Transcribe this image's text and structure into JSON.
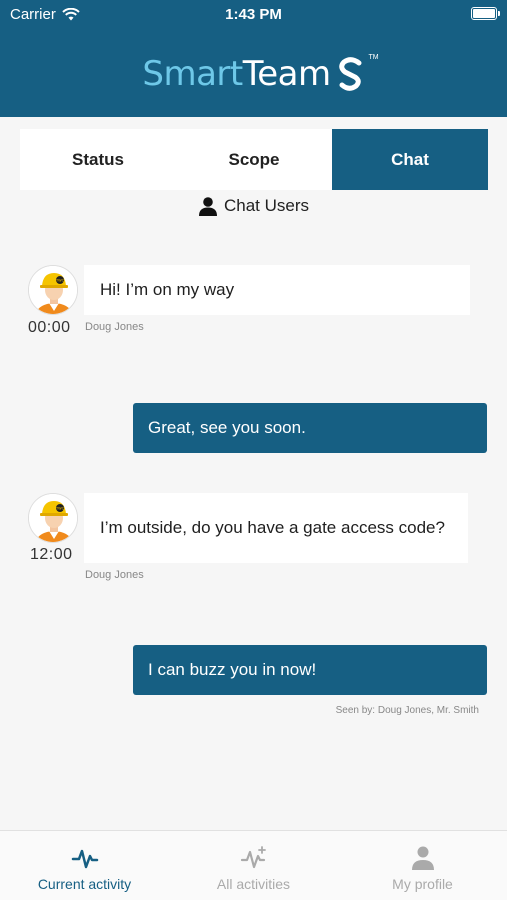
{
  "status_bar": {
    "carrier": "Carrier",
    "time": "1:43 PM"
  },
  "logo": {
    "smart": "Smart",
    "team": "Team",
    "tm": "TM"
  },
  "tabs": [
    {
      "label": "Status",
      "active": false
    },
    {
      "label": "Scope",
      "active": false
    },
    {
      "label": "Chat",
      "active": true
    }
  ],
  "chat_users": {
    "label": "Chat Users"
  },
  "messages": [
    {
      "direction": "incoming",
      "time": "00:00",
      "text": "Hi! I’m on my way",
      "sender": "Doug Jones"
    },
    {
      "direction": "outgoing",
      "text": "Great, see you soon."
    },
    {
      "direction": "incoming",
      "time": "12:00",
      "text": "I’m outside, do you have a gate access code?",
      "sender": "Doug Jones"
    },
    {
      "direction": "outgoing",
      "text": "I can buzz you in now!",
      "seen": "Seen by: Doug Jones, Mr. Smith"
    }
  ],
  "bottom_tabs": [
    {
      "label": "Current activity",
      "icon": "activity-icon",
      "active": true
    },
    {
      "label": "All activities",
      "icon": "activity-sparkle-icon",
      "active": false
    },
    {
      "label": "My profile",
      "icon": "person-icon",
      "active": false
    }
  ],
  "colors": {
    "primary": "#165f83",
    "background": "#f6f6f6",
    "logo_accent": "#6ec8e8"
  }
}
